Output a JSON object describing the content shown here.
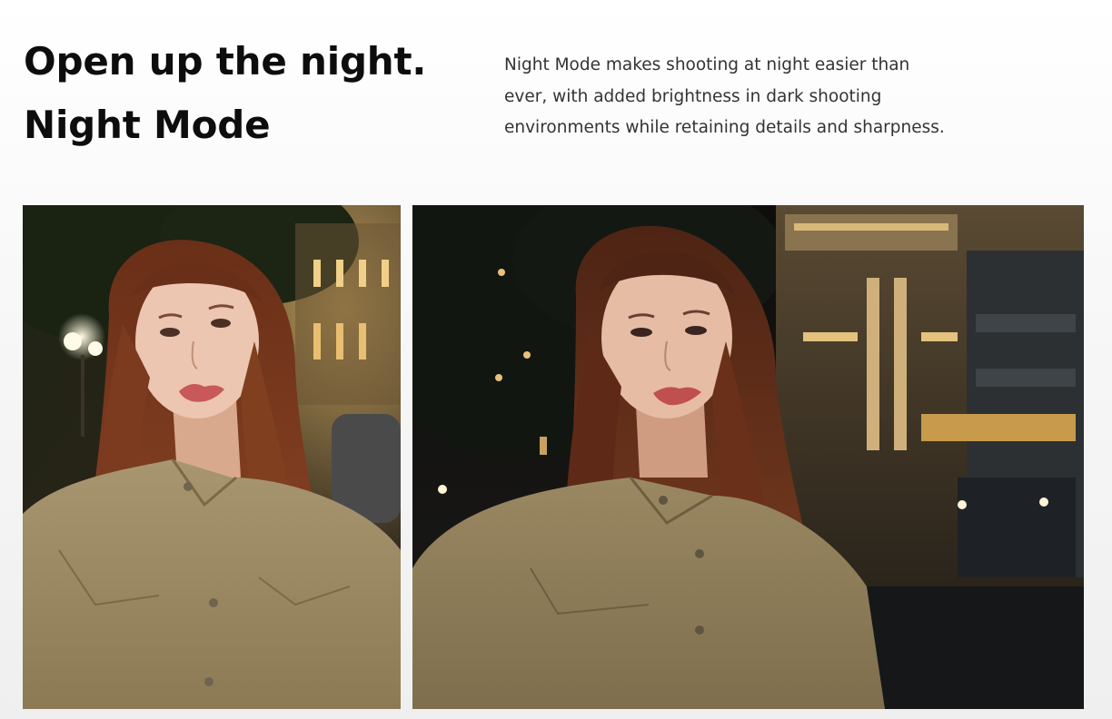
{
  "header": {
    "title_line_1": "Open up the night.",
    "title_line_2": "Night Mode"
  },
  "description": {
    "line_1": "Night Mode makes shooting at night easier than",
    "line_2": "ever, with added brightness in dark shooting",
    "line_3": "environments while retaining details and sharpness."
  },
  "photos": [
    {
      "subject": "woman portrait at night, brightened (Night Mode)",
      "tone": "bright"
    },
    {
      "subject": "woman portrait at night in front of lit building",
      "tone": "dark"
    }
  ],
  "colors": {
    "heading": "#0d0d0d",
    "body_text": "#333333",
    "hair": "#7a3a1f",
    "shirt": "#9a8760",
    "skin": "#e9c2ab"
  }
}
